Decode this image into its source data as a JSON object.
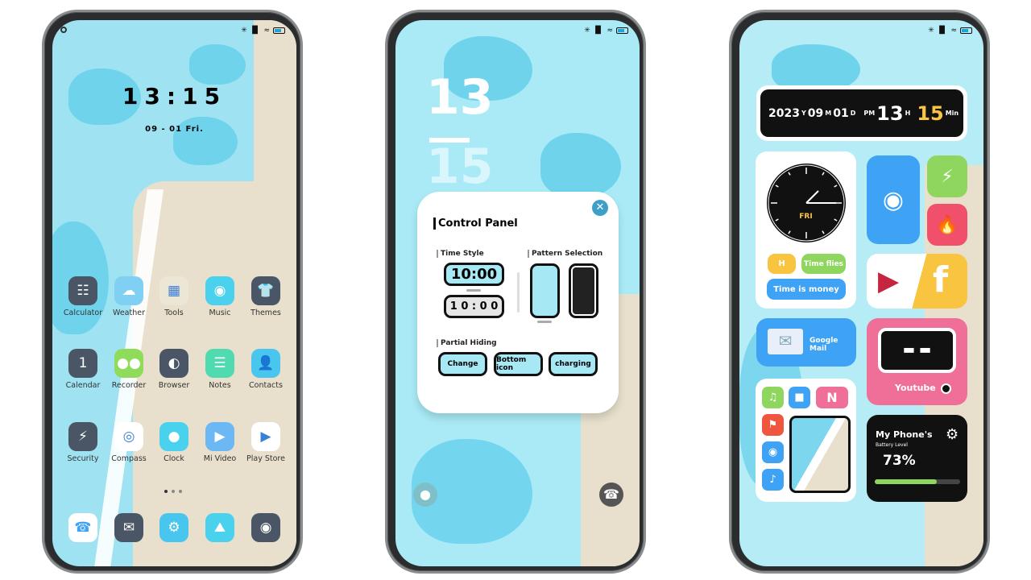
{
  "status": {
    "signal": "✳ ▐▌",
    "battery_level": 75
  },
  "phone1": {
    "clock": "13:15",
    "date": "09 - 01  Fri.",
    "apps": [
      {
        "label": "Calculator",
        "icon": "calculator-icon",
        "color": "#4a5566",
        "glyph": "☷"
      },
      {
        "label": "Weather",
        "icon": "weather-icon",
        "color": "#7fd0f2",
        "glyph": "☁"
      },
      {
        "label": "Tools",
        "icon": "folder-icon",
        "color": "#ece6d6",
        "glyph": "▦"
      },
      {
        "label": "Music",
        "icon": "music-icon",
        "color": "#49d1ee",
        "glyph": "◉"
      },
      {
        "label": "Themes",
        "icon": "themes-icon",
        "color": "#4a5566",
        "glyph": "👕"
      },
      {
        "label": "Calendar",
        "icon": "calendar-icon",
        "color": "#4a5566",
        "glyph": "1"
      },
      {
        "label": "Recorder",
        "icon": "recorder-icon",
        "color": "#8fdc5a",
        "glyph": "●●"
      },
      {
        "label": "Browser",
        "icon": "browser-icon",
        "color": "#4a5566",
        "glyph": "◐"
      },
      {
        "label": "Notes",
        "icon": "notes-icon",
        "color": "#4fdab0",
        "glyph": "☰"
      },
      {
        "label": "Contacts",
        "icon": "contacts-icon",
        "color": "#49c6ee",
        "glyph": "👤"
      },
      {
        "label": "Security",
        "icon": "security-icon",
        "color": "#4a5566",
        "glyph": "⚡"
      },
      {
        "label": "Compass",
        "icon": "compass-icon",
        "color": "#ffffff",
        "glyph": "◎"
      },
      {
        "label": "Clock",
        "icon": "clock-icon",
        "color": "#49d1ee",
        "glyph": "●"
      },
      {
        "label": "Mi Video",
        "icon": "video-icon",
        "color": "#6bb8f5",
        "glyph": "▶"
      },
      {
        "label": "Play Store",
        "icon": "play-store-icon",
        "color": "#ffffff",
        "glyph": "▶"
      }
    ],
    "dock": [
      {
        "icon": "phone-icon",
        "color": "#ffffff",
        "glyph": "☎"
      },
      {
        "icon": "messages-icon",
        "color": "#4a5566",
        "glyph": "✉"
      },
      {
        "icon": "settings-icon",
        "color": "#49c6ee",
        "glyph": "⚙"
      },
      {
        "icon": "gallery-icon",
        "color": "#49d1ee",
        "glyph": "⛰"
      },
      {
        "icon": "camera-icon",
        "color": "#4a5566",
        "glyph": "◉"
      }
    ]
  },
  "phone2": {
    "hour": "13",
    "minute": "15",
    "panel": {
      "title": "Control Panel",
      "time_style": "Time Style",
      "pattern": "Pattern Selection",
      "time1": "10:00",
      "time2": "1 0 : 0 0",
      "partial": "Partial Hiding",
      "buttons": [
        "Change",
        "Bottom icon",
        "charging"
      ]
    }
  },
  "phone3": {
    "date": {
      "year": "2023",
      "y": "Y",
      "month": "09",
      "m": "M",
      "day": "01",
      "d": "D",
      "pm": "PM",
      "hour": "13",
      "h": "H",
      "min": "15",
      "min_unit": "Min"
    },
    "clock_day": "FRI",
    "pills": {
      "h": "H",
      "flies": "Time flies",
      "money": "Time is money"
    },
    "gmail": "Google Mail",
    "youtube": "Youtube",
    "battery": {
      "title": "My Phone's",
      "sub": "Battery Level",
      "value": "73%",
      "percent": 73
    },
    "colors": {
      "accent_blue": "#3ea2f5",
      "green": "#8fd65f",
      "yellow": "#f9c440",
      "pink": "#ef6f98"
    }
  }
}
